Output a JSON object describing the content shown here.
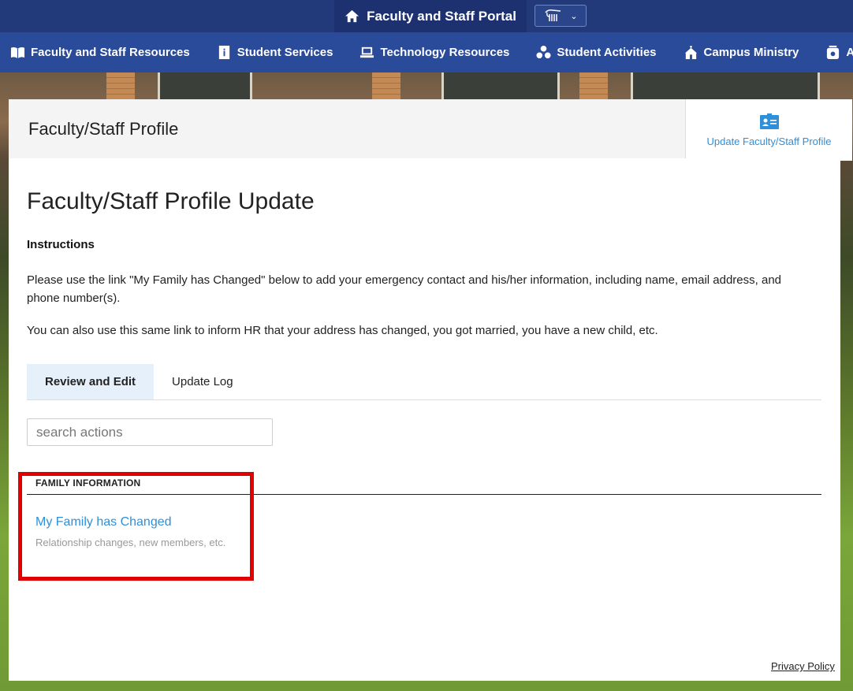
{
  "portal": {
    "title": "Faculty and Staff Portal",
    "home_icon": "home-icon",
    "logo_icon": "university-logo-icon",
    "dropdown_icon": "chevron-down-icon"
  },
  "nav": {
    "items": [
      {
        "label": "Faculty and Staff Resources",
        "icon": "book-icon"
      },
      {
        "label": "Student Services",
        "icon": "info-icon"
      },
      {
        "label": "Technology Resources",
        "icon": "laptop-icon"
      },
      {
        "label": "Student Activities",
        "icon": "people-icon"
      },
      {
        "label": "Campus Ministry",
        "icon": "chapel-icon"
      },
      {
        "label": "Athletics",
        "icon": "trophy-icon"
      }
    ]
  },
  "header": {
    "title": "Faculty/Staff Profile",
    "side_action_label": "Update Faculty/Staff Profile",
    "side_action_icon": "id-card-icon"
  },
  "main": {
    "page_title": "Faculty/Staff Profile Update",
    "instructions_heading": "Instructions",
    "instructions_p1": "Please use the link \"My Family has Changed\" below to add your emergency contact and his/her information, including name, email address, and phone number(s).",
    "instructions_p2": "You can also use this same link to inform HR that your address has changed, you got married, you have a new child, etc.",
    "tabs": [
      {
        "label": "Review and Edit",
        "active": true
      },
      {
        "label": "Update Log",
        "active": false
      }
    ],
    "search": {
      "placeholder": "search actions",
      "value": ""
    },
    "section": {
      "heading": "FAMILY INFORMATION",
      "action_label": "My Family has Changed",
      "action_description": "Relationship changes, new members, etc."
    }
  },
  "footer": {
    "privacy_label": "Privacy Policy"
  },
  "colors": {
    "topbar": "#223a7a",
    "navbar": "#2a4a9a",
    "link": "#2f8fd8",
    "active_tab_bg": "#e6f0fb",
    "highlight": "#e00000"
  }
}
